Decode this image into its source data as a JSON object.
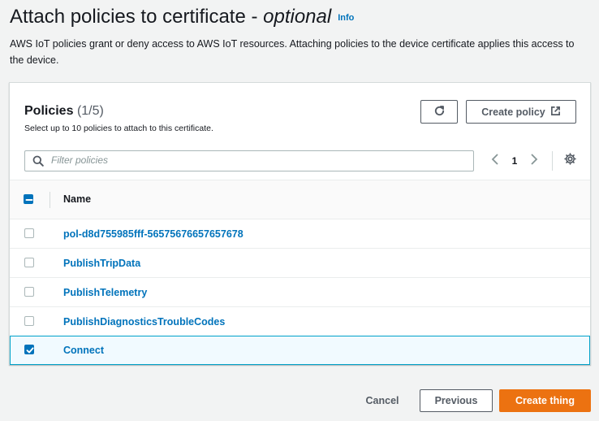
{
  "page": {
    "title_main": "Attach policies to certificate - ",
    "title_optional": "optional",
    "info_label": "Info",
    "description": "AWS IoT policies grant or deny access to AWS IoT resources. Attaching policies to the device certificate applies this access to the device."
  },
  "policies_panel": {
    "title": "Policies",
    "count": "(1/5)",
    "subtitle": "Select up to 10 policies to attach to this certificate.",
    "create_policy_label": "Create policy",
    "filter_placeholder": "Filter policies",
    "current_page": "1",
    "column_name": "Name",
    "rows": [
      {
        "name": "pol-d8d755985fff-56575676657657678",
        "selected": false
      },
      {
        "name": "PublishTripData",
        "selected": false
      },
      {
        "name": "PublishTelemetry",
        "selected": false
      },
      {
        "name": "PublishDiagnosticsTroubleCodes",
        "selected": false
      },
      {
        "name": "Connect",
        "selected": true
      }
    ]
  },
  "footer": {
    "cancel_label": "Cancel",
    "previous_label": "Previous",
    "create_thing_label": "Create thing"
  },
  "colors": {
    "accent_link": "#0073bb",
    "primary_button": "#ec7211",
    "selected_row_bg": "#f1faff",
    "selected_row_border": "#00a1c9"
  },
  "icons": [
    "refresh-icon",
    "external-link-icon",
    "search-icon",
    "chevron-left-icon",
    "chevron-right-icon",
    "gear-icon"
  ]
}
